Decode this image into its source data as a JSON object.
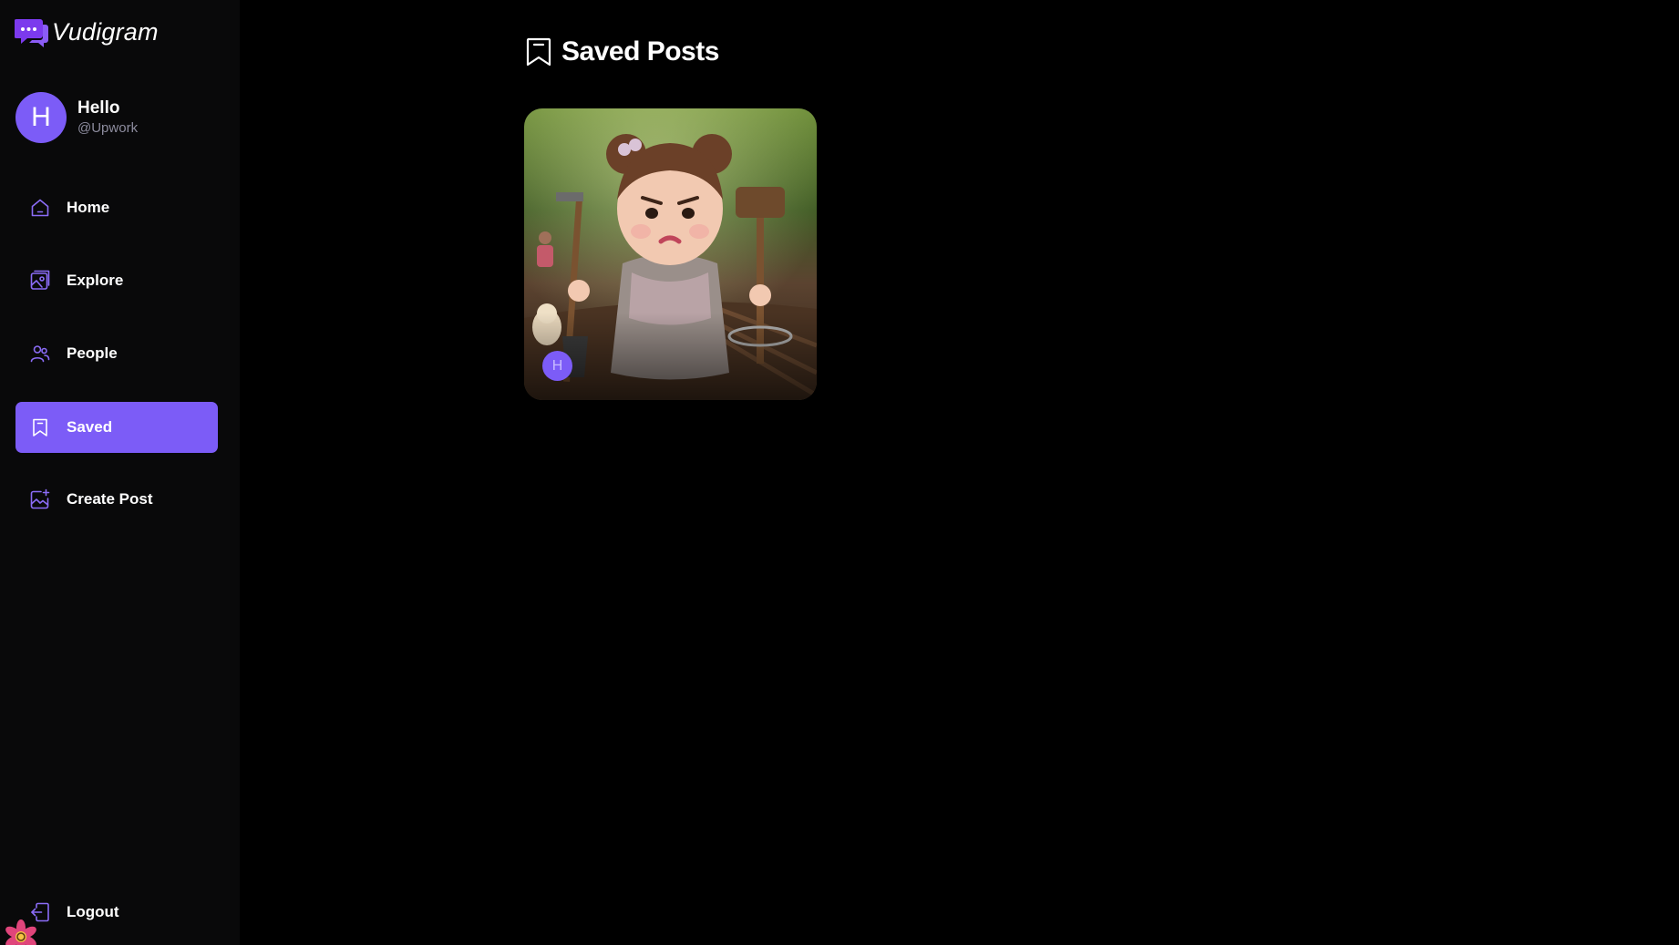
{
  "app": {
    "name": "Vudigram",
    "logo_icon": "chat-bubble-logo-icon",
    "accent_color": "#7c5cf7"
  },
  "profile": {
    "initial": "H",
    "name": "Hello",
    "handle": "@Upwork"
  },
  "nav": {
    "items": [
      {
        "label": "Home",
        "icon": "home-icon",
        "active": false
      },
      {
        "label": "Explore",
        "icon": "explore-icon",
        "active": false
      },
      {
        "label": "People",
        "icon": "people-icon",
        "active": false
      },
      {
        "label": "Saved",
        "icon": "bookmark-icon",
        "active": true
      },
      {
        "label": "Create Post",
        "icon": "create-post-icon",
        "active": false
      }
    ],
    "logout_label": "Logout"
  },
  "main": {
    "title": "Saved Posts",
    "title_icon": "bookmark-icon",
    "posts": [
      {
        "creator_initial": "H",
        "image": "girl-with-shovel-and-mallet-photo"
      }
    ]
  }
}
